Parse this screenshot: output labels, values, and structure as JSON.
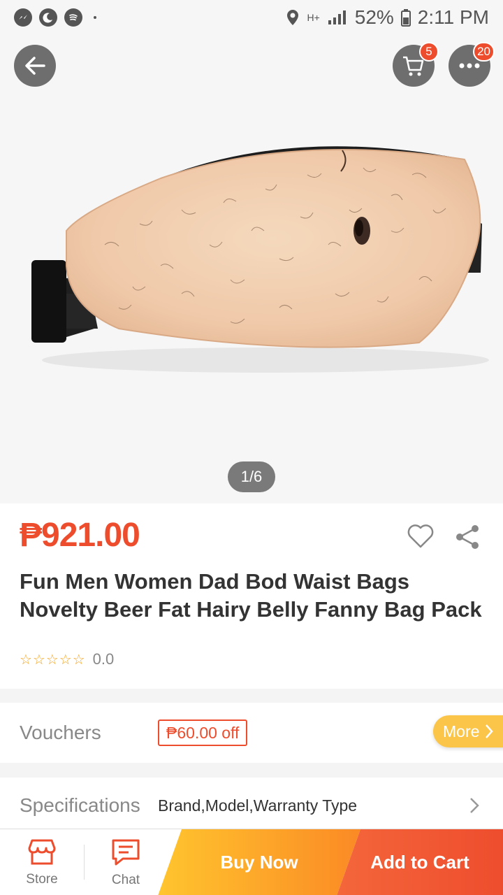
{
  "status_bar": {
    "battery": "52%",
    "time": "2:11 PM",
    "network": "H+"
  },
  "header": {
    "cart_badge": "5",
    "more_badge": "20"
  },
  "gallery": {
    "pager": "1/6"
  },
  "product": {
    "price": "₱921.00",
    "title": "Fun Men Women Dad Bod Waist Bags Novelty Beer Fat Hairy Belly Fanny Bag Pack",
    "stars": "☆☆☆☆☆",
    "rating": "0.0"
  },
  "vouchers": {
    "label": "Vouchers",
    "tag": "₱60.00 off",
    "more": "More"
  },
  "specifications": {
    "label": "Specifications",
    "value": "Brand,Model,Warranty Type"
  },
  "bottom": {
    "store": "Store",
    "chat": "Chat",
    "buy_now": "Buy Now",
    "add_to_cart": "Add to Cart"
  },
  "colors": {
    "accent": "#ee4d2d",
    "buy_now": "#fbb12d",
    "more_button": "#fbc54a"
  }
}
